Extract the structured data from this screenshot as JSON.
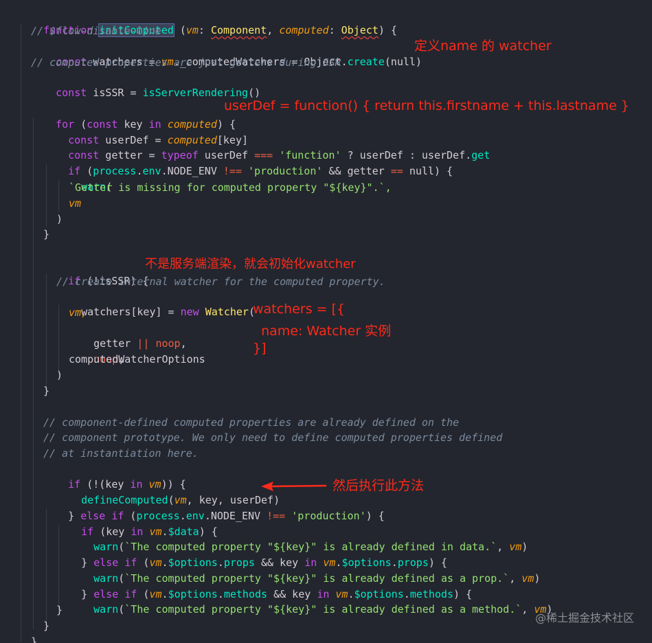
{
  "code": {
    "l1": {
      "kw": "function",
      "name": "initComputed",
      "p1": "vm",
      "c1": ": ",
      "t1": "Component",
      "s1": ", ",
      "p2": "computed",
      "c2": ": ",
      "t2": "Object",
      "end": ") {"
    },
    "l2": "// $flow-disable-line",
    "l3": {
      "kw": "const",
      "a": " watchers = ",
      "b": "vm",
      "c": "._computedWatchers = Object.",
      "d": "create",
      "e": "(null)"
    },
    "l4": "// computed properties are just getters during SSR",
    "l5": {
      "kw": "const",
      "a": " isSSR = ",
      "f": "isServerRendering",
      "e": "()"
    },
    "l7": {
      "kw": "for",
      "a": " (",
      "k2": "const",
      "b": " key ",
      "k3": "in",
      "c": " ",
      "p": "computed",
      "d": ") {"
    },
    "l8": {
      "kw": "const",
      "a": " userDef = ",
      "p": "computed",
      "b": "[key]"
    },
    "l9": {
      "kw": "const",
      "a": " getter = ",
      "k2": "typeof",
      "b": " userDef ",
      "op": "===",
      "c": " ",
      "s": "'function'",
      "d": " ? userDef : userDef.",
      "f": "get"
    },
    "l10": {
      "kw": "if",
      "a": " (",
      "p": "process",
      "b": ".",
      "c": "env",
      "d": ".NODE_ENV ",
      "op": "!==",
      "e": " ",
      "s": "'production'",
      "g": " && getter ",
      "op2": "==",
      "h": " null) {"
    },
    "l11": {
      "f": "warn",
      "a": "("
    },
    "l12": "`Getter is missing for computed property \"${key}\".`,",
    "l13": "vm",
    "l14": ")",
    "l15": "}",
    "l17": {
      "kw": "if",
      "a": " (!isSSR) {"
    },
    "l18": "// create internal watcher for the computed property.",
    "l19": {
      "a": "watchers[key] = ",
      "kw": "new",
      "b": " ",
      "t": "Watcher",
      "c": "("
    },
    "l20": "vm,",
    "l21": {
      "a": "getter ",
      "op": "||",
      "b": " ",
      "p": "noop",
      "c": ","
    },
    "l22": {
      "p": "noop",
      "c": ","
    },
    "l23": "computedWatcherOptions",
    "l24": ")",
    "l25": "}",
    "l27": "// component-defined computed properties are already defined on the",
    "l28": "// component prototype. We only need to define computed properties defined",
    "l29": "// at instantiation here.",
    "l30": {
      "kw": "if",
      "a": " (!(key ",
      "k2": "in",
      "b": " ",
      "p": "vm",
      "c": ")) {"
    },
    "l31": {
      "f": "defineComputed",
      "a": "(",
      "p": "vm",
      "b": ", key, userDef)"
    },
    "l32": {
      "a": "} ",
      "kw": "else",
      "b": " ",
      "k2": "if",
      "c": " (",
      "p": "process",
      "d": ".",
      "e": "env",
      "g": ".NODE_ENV ",
      "op": "!==",
      "h": " ",
      "s": "'production'",
      "i": ") {"
    },
    "l33": {
      "kw": "if",
      "a": " (key ",
      "k2": "in",
      "b": " ",
      "p": "vm",
      "c": ".",
      "d": "$data",
      "e": ") {"
    },
    "l34": {
      "f": "warn",
      "a": "(",
      "s": "`The computed property \"${key}\" is already defined in data.`",
      "b": ", ",
      "p": "vm",
      "c": ")"
    },
    "l35": {
      "a": "} ",
      "kw": "else",
      "b": " ",
      "k2": "if",
      "c": " (",
      "p": "vm",
      "d": ".",
      "e": "$options",
      "g": ".",
      "h": "props",
      "i": " && key ",
      "k3": "in",
      "j": " ",
      "p2": "vm",
      "k": ".",
      "l": "$options",
      "m": ".",
      "n": "props",
      "o": ") {"
    },
    "l36": {
      "f": "warn",
      "a": "(",
      "s": "`The computed property \"${key}\" is already defined as a prop.`",
      "b": ", ",
      "p": "vm",
      "c": ")"
    },
    "l37": {
      "a": "} ",
      "kw": "else",
      "b": " ",
      "k2": "if",
      "c": " (",
      "p": "vm",
      "d": ".",
      "e": "$options",
      "g": ".",
      "h": "methods",
      "i": " && key ",
      "k3": "in",
      "j": " ",
      "p2": "vm",
      "k": ".",
      "l": "$options",
      "m": ".",
      "n": "methods",
      "o": ") {"
    },
    "l38": {
      "f": "warn",
      "a": "(",
      "s": "`The computed property \"${key}\" is already defined as a method.`",
      "b": ", ",
      "p": "vm",
      "c": ")"
    },
    "l39": "}",
    "l40": "}",
    "l41": "}"
  },
  "annotations": {
    "a1": "定义name 的 watcher",
    "a2": "userDef = function() { return this.firstname + this.lastname }",
    "a3": "不是服务端渲染，就会初始化watcher",
    "a4a": "watchers = [{",
    "a4b": "  name: Watcher 实例",
    "a4c": "}]",
    "a5": "然后执行此方法"
  },
  "watermark": "@稀土掘金技术社区",
  "colors": {
    "background": "#23262e",
    "annotation": "#ff2a1a",
    "keyword": "#c74ded",
    "string": "#96e072",
    "comment": "#7c8a9e"
  }
}
